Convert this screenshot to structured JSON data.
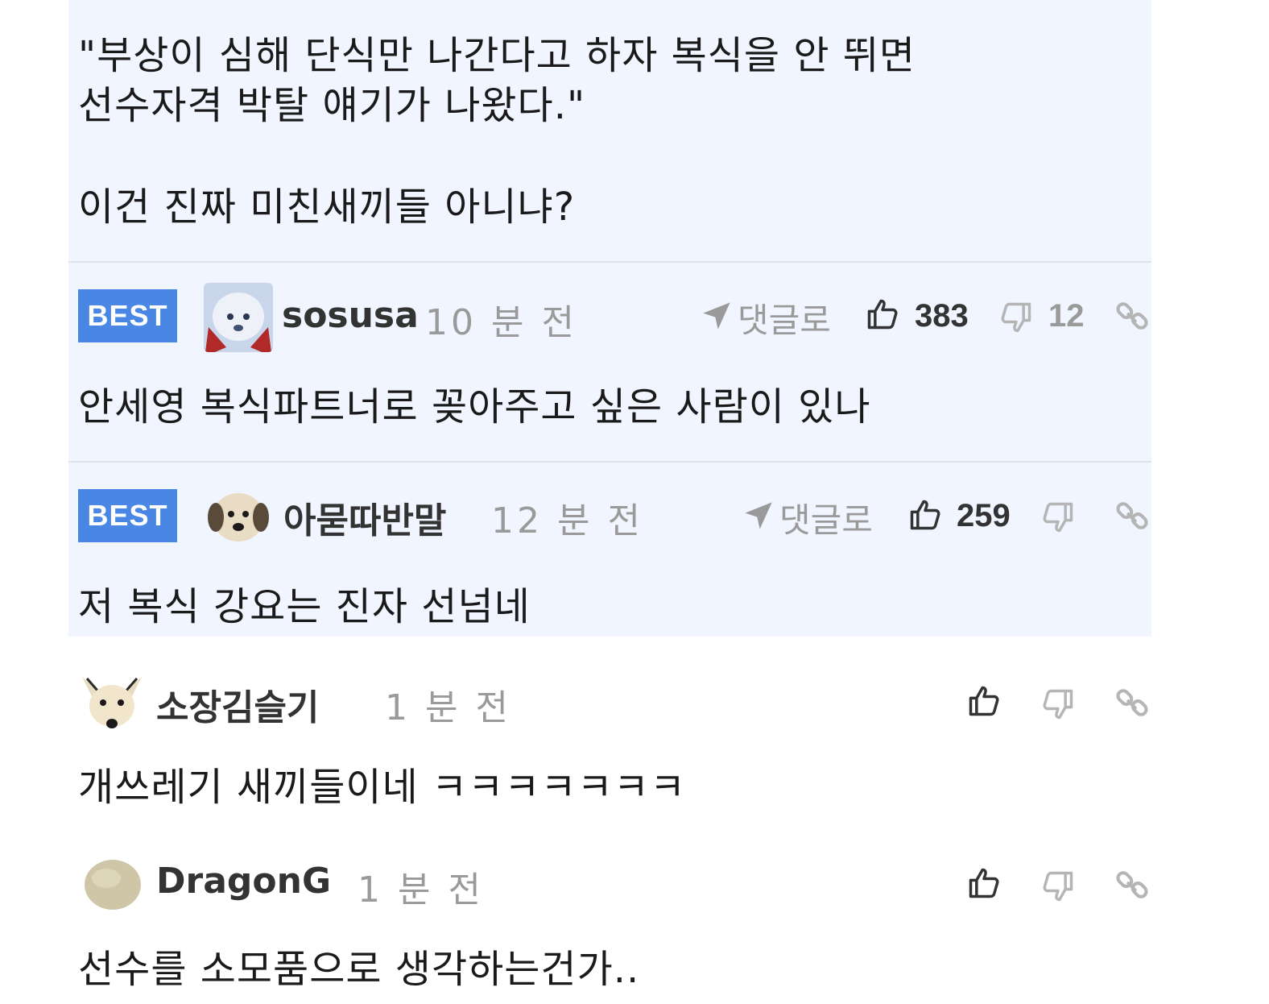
{
  "colors": {
    "best_badge": "#4a86e4",
    "best_background": "#f0f5ff",
    "muted": "#9a9a9a",
    "text": "#1a1a1a"
  },
  "post_excerpt": {
    "line1": "\"부상이 심해 단식만 나간다고 하자 복식을 안 뛰면",
    "line2": "선수자격 박탈 얘기가 나왔다.\"",
    "line3": "이건 진짜 미친새끼들 아니냐?"
  },
  "comments": [
    {
      "badge": "BEST",
      "nickname": "sosusa",
      "time": "10 분 전",
      "reply_label": "댓글로",
      "likes": "383",
      "dislikes": "12",
      "text": "안세영 복식파트너로 꽂아주고 싶은 사람이 있나",
      "avatar_icon": "dog-avatar-icon"
    },
    {
      "badge": "BEST",
      "nickname": "아묻따반말",
      "time": "12 분 전",
      "reply_label": "댓글로",
      "likes": "259",
      "dislikes": "",
      "text": "저 복식 강요는 진자 선넘네",
      "avatar_icon": "puppy-avatar-icon"
    },
    {
      "badge": "",
      "nickname": "소장김슬기",
      "time": "1 분 전",
      "reply_label": "",
      "likes": "",
      "dislikes": "",
      "text": "개쓰레기 새끼들이네 ㅋㅋㅋㅋㅋㅋㅋ",
      "avatar_icon": "chihuahua-avatar-icon"
    },
    {
      "badge": "",
      "nickname": "DragonG",
      "time": "1 분 전",
      "reply_label": "",
      "likes": "",
      "dislikes": "",
      "text": "선수를 소모품으로 생각하는건가..",
      "avatar_icon": "blob-avatar-icon"
    }
  ]
}
